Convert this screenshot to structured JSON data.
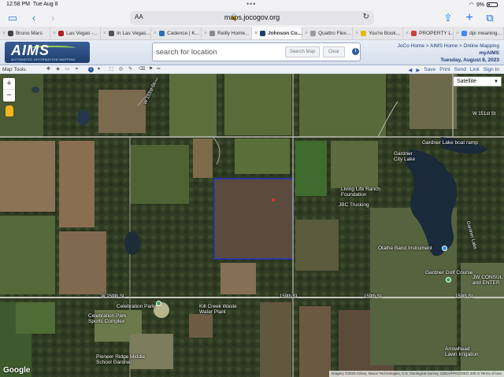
{
  "status_bar": {
    "time": "12:58 PM",
    "day": "Tue Aug 8",
    "battery": "9%"
  },
  "browser": {
    "url": "maps.jocogov.org",
    "aa_label": "AA",
    "tabs": [
      {
        "label": "Bruno Mars",
        "color": "#444444"
      },
      {
        "label": "Las Vegas -...",
        "color": "#b02020"
      },
      {
        "label": "In Las Vegas...",
        "color": "#555555"
      },
      {
        "label": "Cadence | K...",
        "color": "#2a6db5"
      },
      {
        "label": "Reilly Home...",
        "color": "#888888"
      },
      {
        "label": "Johnson Co...",
        "color": "#1f3d6e",
        "active": true
      },
      {
        "label": "Quattro Flex...",
        "color": "#999999"
      },
      {
        "label": "You're Book...",
        "color": "#e6b800"
      },
      {
        "label": "PROPERTY L...",
        "color": "#d04040"
      },
      {
        "label": "dpi meaning...",
        "color": "#4285f4"
      }
    ]
  },
  "header": {
    "logo_text": "AIMS",
    "logo_subtitle": "AUTOMATED INFORMATION MAPPING SYSTEM",
    "search_placeholder": "search for location",
    "search_button": "Search Map",
    "clear_button": "Clear",
    "breadcrumb": "JoCo Home > AIMS Home > Online Mapping",
    "my_aims": "myAIMS",
    "date": "Tuesday, August 8, 2023"
  },
  "map_tools": {
    "label": "Map Tools:",
    "actions": [
      "Save",
      "Print",
      "Send",
      "Link",
      "Sign In"
    ]
  },
  "map": {
    "basemap_selected": "Satellite",
    "google_label": "Google",
    "attribution": "Imagery ©2023 Airbus, Maxar Technologies, U.S. Geological Survey, USDA/FPAC/GEO  200 m  Terms of Use",
    "labels": {
      "w151": "W 151st St",
      "w151b": "W 151st St",
      "gardner_ramp": "Gardner Lake boat ramp",
      "gardner_city": "Gardner\nCity Lake",
      "living_life": "Living Life Ranch\nFoundation",
      "jbc": "JBC Trucking",
      "olathe_band": "Olathe Band Instrument",
      "golf": "Gardner Golf Course",
      "jw": "JW CONSUL\nand ENTER",
      "w159": "W 159th St",
      "s159a": "159th St",
      "s159b": "159th St",
      "s159c": "159th St",
      "celebration_park": "Celebration Park",
      "celebration_sports": "Celebration Park\nSports Complex",
      "kill_creek": "Kill Creek Waste\nWater Plant",
      "pioneer": "Pioneer Ridge Middle\nSchool Gardner",
      "arrowhead": "Arrowhead\nLawn Irrigation",
      "gardner_lake_road": "Gardner Lake"
    }
  }
}
